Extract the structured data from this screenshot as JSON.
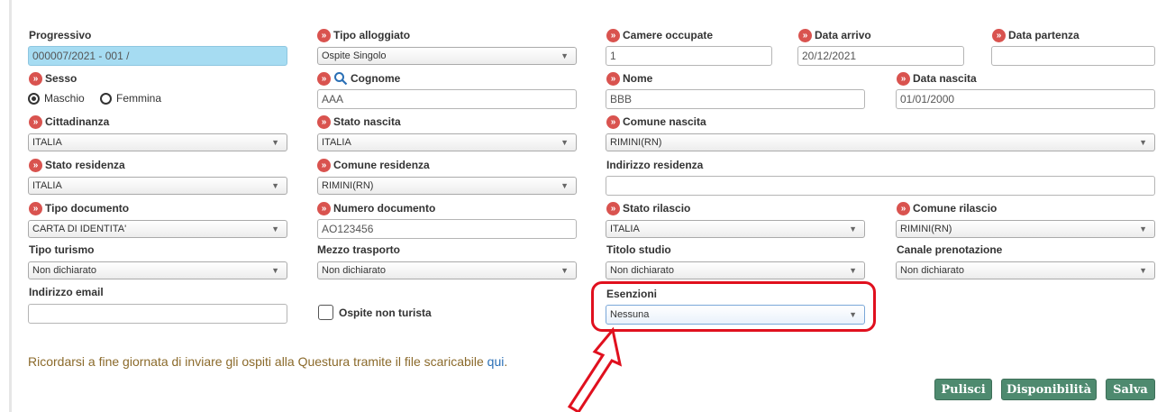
{
  "row1": {
    "progressivo": {
      "label": "Progressivo",
      "value": "000007/2021  - 001 /"
    },
    "tipo_alloggiato": {
      "label": "Tipo alloggiato",
      "value": "Ospite Singolo"
    },
    "camere_occupate": {
      "label": "Camere occupate",
      "value": "1"
    },
    "data_arrivo": {
      "label": "Data arrivo",
      "value": "20/12/2021"
    },
    "data_partenza": {
      "label": "Data partenza",
      "value": ""
    }
  },
  "row2": {
    "sesso": {
      "label": "Sesso",
      "options": [
        "Maschio",
        "Femmina"
      ],
      "selected": "Maschio"
    },
    "cognome": {
      "label": "Cognome",
      "value": "AAA"
    },
    "nome": {
      "label": "Nome",
      "value": "BBB"
    },
    "data_nascita": {
      "label": "Data nascita",
      "value": "01/01/2000"
    }
  },
  "row3": {
    "cittadinanza": {
      "label": "Cittadinanza",
      "value": "ITALIA"
    },
    "stato_nascita": {
      "label": "Stato nascita",
      "value": "ITALIA"
    },
    "comune_nascita": {
      "label": "Comune nascita",
      "value": "RIMINI(RN)"
    }
  },
  "row4": {
    "stato_residenza": {
      "label": "Stato residenza",
      "value": "ITALIA"
    },
    "comune_residenza": {
      "label": "Comune residenza",
      "value": "RIMINI(RN)"
    },
    "indirizzo_residenza": {
      "label": "Indirizzo residenza",
      "value": ""
    }
  },
  "row5": {
    "tipo_documento": {
      "label": "Tipo documento",
      "value": "CARTA DI IDENTITA'"
    },
    "numero_documento": {
      "label": "Numero documento",
      "value": "AO123456"
    },
    "stato_rilascio": {
      "label": "Stato rilascio",
      "value": "ITALIA"
    },
    "comune_rilascio": {
      "label": "Comune rilascio",
      "value": "RIMINI(RN)"
    }
  },
  "row6": {
    "tipo_turismo": {
      "label": "Tipo turismo",
      "value": "Non dichiarato"
    },
    "mezzo_trasporto": {
      "label": "Mezzo trasporto",
      "value": "Non dichiarato"
    },
    "titolo_studio": {
      "label": "Titolo studio",
      "value": "Non dichiarato"
    },
    "canale_prenotazione": {
      "label": "Canale prenotazione",
      "value": "Non dichiarato"
    }
  },
  "row7": {
    "indirizzo_email": {
      "label": "Indirizzo email",
      "value": ""
    },
    "ospite_non_turista": {
      "label": "Ospite non turista",
      "checked": false
    },
    "esenzioni": {
      "label": "Esenzioni",
      "value": "Nessuna"
    }
  },
  "note": {
    "text": "Ricordarsi a fine giornata di inviare gli ospiti alla Questura tramite il file scaricabile ",
    "link": "qui",
    "end": "."
  },
  "buttons": {
    "pulisci": "Pulisci",
    "disponibilita": "Disponibilità",
    "salva": "Salva"
  },
  "colors": {
    "required_badge": "#d9534f",
    "button": "#4e8a6f",
    "highlight": "#e0101e",
    "readonly_field": "#a6dcf2"
  },
  "icons": {
    "required": "double-chevron-right-icon",
    "search": "search-icon",
    "annotation": "red-arrow"
  }
}
